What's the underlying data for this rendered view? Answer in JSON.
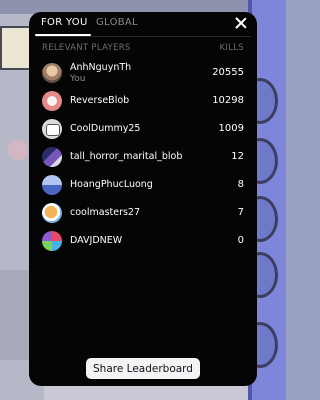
{
  "tabs": [
    {
      "label": "FOR YOU",
      "active": true
    },
    {
      "label": "GLOBAL",
      "active": false
    }
  ],
  "columns": {
    "players": "RELEVANT PLAYERS",
    "kills": "KILLS"
  },
  "players": [
    {
      "name": "AnhNguynTh",
      "subtitle": "You",
      "kills": "20555",
      "avatar": "player-avatar"
    },
    {
      "name": "ReverseBlob",
      "kills": "10298",
      "avatar": "player-avatar"
    },
    {
      "name": "CoolDummy25",
      "kills": "1009",
      "avatar": "player-avatar"
    },
    {
      "name": "tall_horror_marital_blob",
      "kills": "12",
      "avatar": "player-avatar"
    },
    {
      "name": "HoangPhucLuong",
      "kills": "8",
      "avatar": "player-avatar"
    },
    {
      "name": "coolmasters27",
      "kills": "7",
      "avatar": "player-avatar"
    },
    {
      "name": "DAVJDNEW",
      "kills": "0",
      "avatar": "player-avatar"
    }
  ],
  "share_label": "Share Leaderboard",
  "icons": {
    "close": "close-icon"
  },
  "colors": {
    "modal_bg": "#050506",
    "text": "#ffffff",
    "muted": "#8a8a8f",
    "button_bg": "#f4f4f7"
  }
}
